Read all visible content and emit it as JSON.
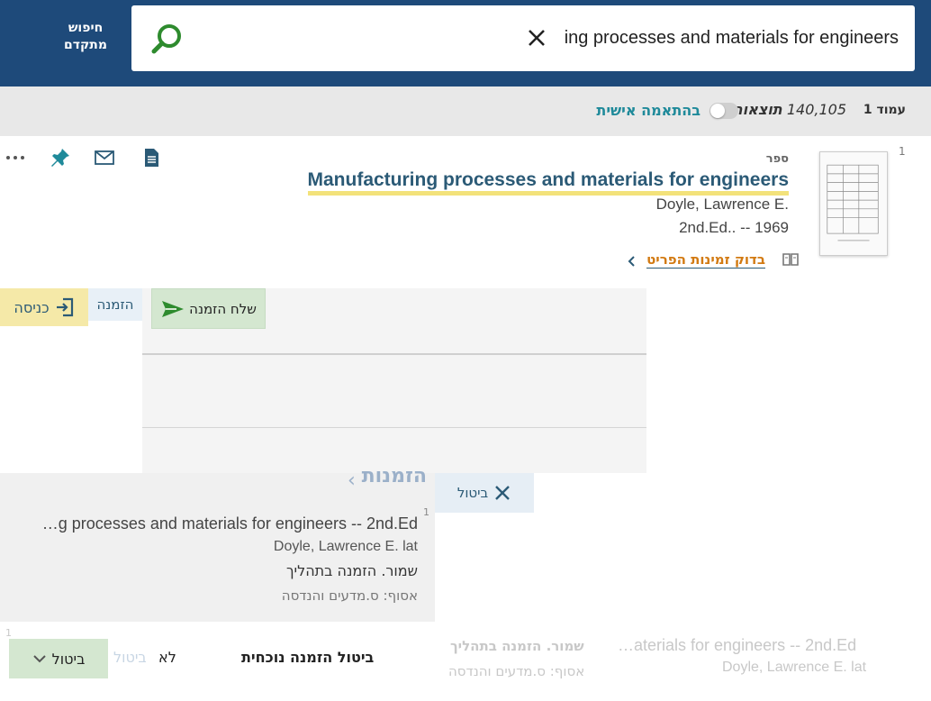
{
  "header": {
    "advanced_search_label": "חיפוש מתקדם",
    "search": {
      "value": "ing processes and materials for engineers",
      "placeholder": ""
    }
  },
  "results_bar": {
    "page_label": "עמוד 1",
    "result_count": "140,105",
    "results_word": "תוצאות",
    "personalize_label": "בהתאמה אישית"
  },
  "result": {
    "number": "1",
    "type": "ספר",
    "title": "Manufacturing processes and materials for engineers",
    "author": "Doyle, Lawrence E.",
    "edition": "2nd.Ed.. -- 1969",
    "availability_link": "בדוק זמינות הפריט"
  },
  "request_panel": {
    "send_request_label": "שלח הזמנה",
    "request_tab_label": "הזמנה",
    "login_label": "כניסה"
  },
  "requests": {
    "title": "הזמנות",
    "cancel_label": "ביטול",
    "item": {
      "number": "1",
      "title": "…g processes and materials for engineers -- 2nd.Ed",
      "author": "Doyle, Lawrence E. lat",
      "status": "שמור. הזמנה בתהליך",
      "collection": "אסוף: ס.מדעים והנדסה"
    }
  },
  "ghost": {
    "title": "…aterials for engineers -- 2nd.Ed",
    "author": "Doyle, Lawrence E. lat",
    "status": "שמור. הזמנה בתהליך",
    "collection": "אסוף: ס.מדעים והנדסה",
    "number": "1"
  },
  "cancel_bar": {
    "question": "ביטול הזמנה נוכחית",
    "no_label": "לא",
    "ghost_cancel": "ביטול",
    "cancel_button_label": "ביטול"
  },
  "colors": {
    "header_bg": "#1e4a7a",
    "accent_link": "#2b5a76",
    "availability_orange": "#d27a12",
    "highlight_yellow": "#f3e27a",
    "search_green": "#2e8b2e"
  },
  "icons": {
    "search": "search-icon",
    "clear": "close-icon",
    "document": "document-icon",
    "email": "email-icon",
    "pin": "pin-icon",
    "more": "more-icon",
    "book": "book-icon",
    "chevron": "chevron-right-icon",
    "send": "send-icon",
    "login": "login-icon",
    "cancel": "close-icon",
    "chevron_down": "chevron-down-icon"
  }
}
